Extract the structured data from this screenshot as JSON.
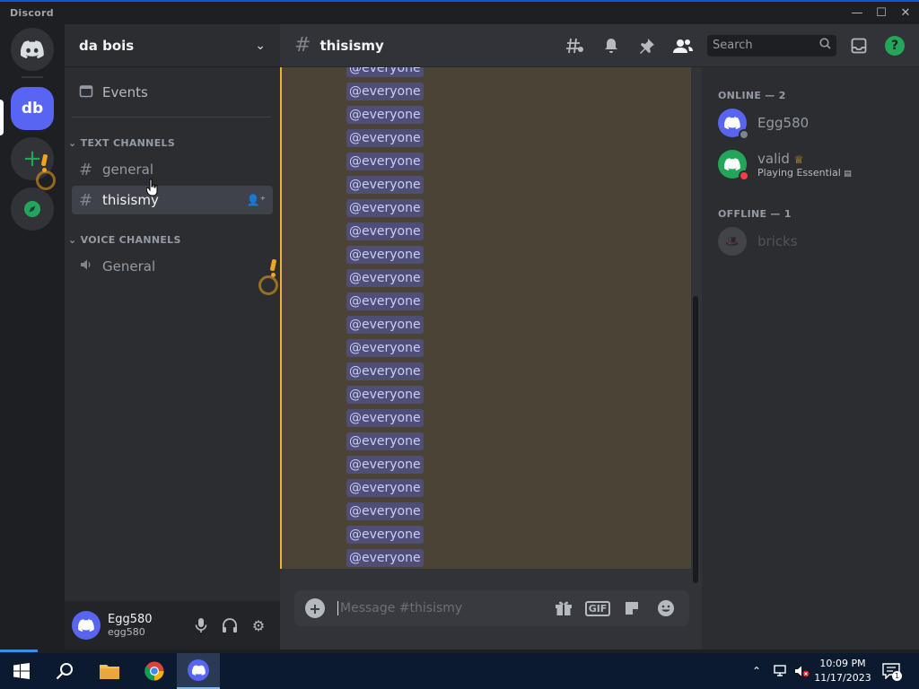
{
  "window": {
    "title": "Discord"
  },
  "rail": {
    "server_initials": "db"
  },
  "guild": {
    "name": "da bois"
  },
  "sidebar": {
    "events_label": "Events",
    "text_category": "TEXT CHANNELS",
    "text_channels": [
      "general",
      "thisismy"
    ],
    "voice_category": "VOICE CHANNELS",
    "voice_channels": [
      "General"
    ]
  },
  "user": {
    "display_name": "Egg580",
    "username": "egg580"
  },
  "channel": {
    "name": "thisismy"
  },
  "search": {
    "placeholder": "Search"
  },
  "messages": {
    "mention_text": "@everyone"
  },
  "composer": {
    "placeholder": "Message #thisismy",
    "gif_label": "GIF"
  },
  "members": {
    "online_header": "ONLINE — 2",
    "offline_header": "OFFLINE — 1",
    "list": [
      {
        "name": "Egg580",
        "activity": ""
      },
      {
        "name": "valid",
        "activity": "Playing Essential"
      },
      {
        "name": "bricks",
        "activity": ""
      }
    ]
  },
  "taskbar": {
    "time": "10:09 PM",
    "date": "11/17/2023",
    "notification_count": "1"
  },
  "colors": {
    "accent": "#5865f2",
    "online": "#23a55a",
    "dnd": "#f23f43",
    "mention_bg": "#5865f2",
    "unread_border": "#f0b232"
  }
}
